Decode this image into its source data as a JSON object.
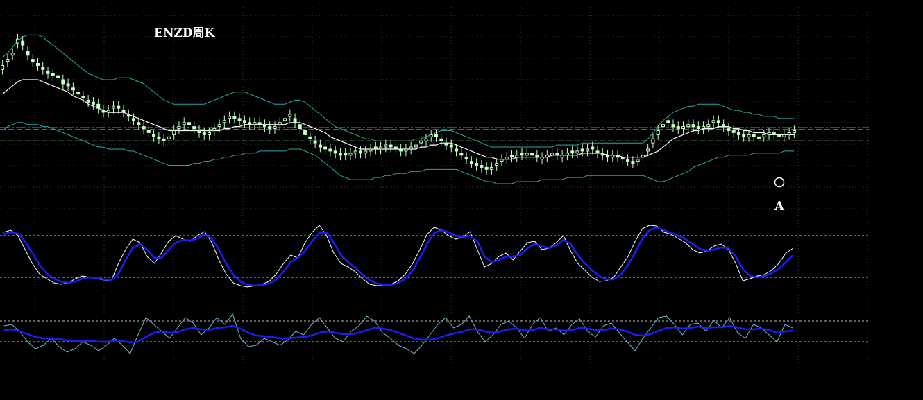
{
  "chart_data": {
    "title": "ENZD周K",
    "panels": [
      {
        "type": "candlestick",
        "bars": 158,
        "ylim": [
          0,
          100
        ],
        "candles_close": [
          74,
          77,
          80,
          87,
          84,
          79,
          76,
          74,
          72,
          70,
          69,
          68,
          65,
          64,
          62,
          60,
          58,
          56,
          55,
          53,
          51,
          52,
          54,
          53,
          51,
          49,
          47,
          45,
          43,
          41,
          39,
          38,
          37,
          39,
          42,
          44,
          46,
          45,
          43,
          41,
          40,
          41,
          43,
          45,
          47,
          49,
          48,
          47,
          46,
          45,
          46,
          45,
          44,
          43,
          44,
          46,
          48,
          50,
          46,
          43,
          40,
          38,
          36,
          34,
          33,
          32,
          31,
          30,
          30,
          31,
          32,
          31,
          32,
          33,
          33,
          34,
          35,
          34,
          33,
          32,
          33,
          34,
          35,
          37,
          38,
          40,
          39,
          37,
          35,
          34,
          32,
          30,
          28,
          26,
          25,
          24,
          23,
          24,
          26,
          28,
          29,
          29,
          30,
          30,
          31,
          30,
          29,
          29,
          30,
          31,
          30,
          30,
          31,
          31,
          32,
          32,
          33,
          33,
          31,
          30,
          29,
          30,
          29,
          28,
          27,
          26,
          28,
          30,
          33,
          38,
          42,
          45,
          46,
          44,
          43,
          44,
          45,
          44,
          43,
          44,
          45,
          47,
          46,
          44,
          42,
          41,
          40,
          39,
          40,
          39,
          38,
          40,
          41,
          40,
          39,
          40,
          41,
          42
        ],
        "candles_open": [
          72,
          76,
          79,
          85,
          86,
          81,
          77,
          75,
          73,
          71,
          70,
          69,
          67,
          65,
          63,
          61,
          59,
          57,
          56,
          55,
          52,
          51,
          53,
          54,
          52,
          50,
          48,
          46,
          44,
          42,
          40,
          39,
          38,
          38,
          40,
          43,
          45,
          46,
          44,
          42,
          41,
          40,
          42,
          44,
          46,
          48,
          49,
          48,
          47,
          46,
          45,
          46,
          45,
          44,
          43,
          45,
          47,
          49,
          48,
          45,
          42,
          39,
          37,
          35,
          34,
          33,
          32,
          31,
          31,
          30,
          31,
          32,
          31,
          32,
          34,
          33,
          34,
          35,
          34,
          33,
          32,
          33,
          34,
          36,
          37,
          39,
          40,
          38,
          36,
          35,
          33,
          31,
          29,
          27,
          26,
          25,
          24,
          23,
          25,
          27,
          28,
          30,
          29,
          31,
          30,
          31,
          30,
          28,
          29,
          30,
          31,
          29,
          30,
          32,
          31,
          33,
          32,
          34,
          32,
          31,
          30,
          29,
          30,
          29,
          28,
          27,
          27,
          29,
          32,
          36,
          40,
          44,
          47,
          45,
          44,
          43,
          44,
          45,
          44,
          43,
          44,
          46,
          47,
          45,
          43,
          42,
          41,
          40,
          39,
          40,
          39,
          39,
          40,
          41,
          40,
          39,
          40,
          41
        ],
        "ma_line": [
          60,
          62,
          64,
          66,
          67,
          67,
          67,
          67,
          66,
          65,
          64,
          63,
          62,
          61,
          59,
          58,
          57,
          55,
          54,
          53,
          52,
          51,
          51,
          51,
          51,
          50,
          49,
          48,
          47,
          46,
          45,
          44,
          43,
          42,
          42,
          42,
          42,
          42,
          42,
          42,
          42,
          42,
          42,
          42,
          43,
          43,
          44,
          44,
          45,
          45,
          45,
          45,
          45,
          45,
          45,
          45,
          45,
          46,
          46,
          46,
          45,
          44,
          43,
          42,
          41,
          39,
          38,
          37,
          36,
          35,
          34,
          33,
          33,
          33,
          33,
          33,
          33,
          33,
          33,
          33,
          33,
          33,
          33,
          34,
          34,
          35,
          35,
          36,
          36,
          36,
          35,
          34,
          33,
          32,
          31,
          30,
          29,
          29,
          28,
          28,
          28,
          28,
          29,
          29,
          29,
          29,
          29,
          29,
          29,
          30,
          30,
          30,
          30,
          30,
          30,
          31,
          31,
          31,
          31,
          31,
          30,
          30,
          30,
          29,
          29,
          29,
          29,
          29,
          30,
          31,
          32,
          34,
          36,
          38,
          39,
          40,
          41,
          42,
          42,
          43,
          43,
          43,
          44,
          44,
          44,
          43,
          43,
          42,
          42,
          41,
          41,
          41,
          40,
          40,
          40,
          40,
          40,
          40
        ],
        "bb_upper": [
          78,
          80,
          83,
          86,
          88,
          89,
          89,
          89,
          88,
          86,
          84,
          82,
          80,
          78,
          76,
          74,
          72,
          70,
          69,
          68,
          67,
          67,
          67,
          68,
          68,
          68,
          67,
          66,
          65,
          63,
          61,
          59,
          57,
          56,
          55,
          55,
          55,
          55,
          55,
          55,
          55,
          56,
          57,
          58,
          59,
          60,
          61,
          61,
          61,
          60,
          59,
          58,
          57,
          56,
          55,
          55,
          55,
          56,
          57,
          57,
          56,
          54,
          52,
          50,
          48,
          46,
          44,
          43,
          42,
          41,
          40,
          39,
          38,
          38,
          37,
          37,
          37,
          37,
          37,
          37,
          37,
          37,
          38,
          38,
          39,
          40,
          41,
          42,
          42,
          42,
          41,
          40,
          39,
          38,
          37,
          36,
          35,
          34,
          34,
          34,
          34,
          34,
          34,
          34,
          34,
          34,
          34,
          34,
          34,
          34,
          35,
          35,
          35,
          35,
          35,
          36,
          36,
          36,
          36,
          36,
          36,
          36,
          36,
          36,
          36,
          36,
          36,
          36,
          38,
          41,
          44,
          47,
          49,
          51,
          52,
          53,
          54,
          54,
          55,
          55,
          55,
          55,
          55,
          54,
          53,
          52,
          52,
          51,
          51,
          50,
          50,
          49,
          49,
          49,
          48,
          48,
          48,
          48
        ],
        "bb_lower": [
          42,
          44,
          45,
          46,
          46,
          45,
          45,
          45,
          44,
          44,
          43,
          42,
          41,
          40,
          39,
          38,
          37,
          36,
          35,
          34,
          34,
          33,
          33,
          33,
          33,
          32,
          32,
          31,
          30,
          29,
          28,
          27,
          26,
          25,
          25,
          25,
          25,
          25,
          26,
          26,
          27,
          27,
          28,
          28,
          29,
          29,
          30,
          30,
          31,
          31,
          31,
          32,
          32,
          32,
          32,
          32,
          32,
          33,
          33,
          33,
          32,
          31,
          30,
          28,
          26,
          24,
          22,
          20,
          19,
          18,
          18,
          18,
          18,
          18,
          19,
          19,
          20,
          20,
          21,
          21,
          21,
          22,
          22,
          22,
          23,
          23,
          23,
          23,
          23,
          23,
          23,
          22,
          21,
          20,
          19,
          18,
          17,
          17,
          16,
          16,
          16,
          16,
          17,
          17,
          17,
          17,
          17,
          18,
          18,
          18,
          18,
          18,
          19,
          19,
          19,
          19,
          20,
          20,
          20,
          20,
          20,
          20,
          20,
          20,
          20,
          20,
          20,
          20,
          19,
          18,
          17,
          17,
          18,
          19,
          20,
          21,
          22,
          24,
          25,
          26,
          27,
          28,
          29,
          29,
          30,
          30,
          30,
          30,
          30,
          31,
          31,
          31,
          31,
          31,
          31,
          32,
          32,
          32
        ],
        "support_levels": [
          43.5,
          42.5,
          37
        ]
      },
      {
        "type": "oscillator",
        "ylim": [
          0,
          100
        ],
        "levels": [
          80,
          20
        ],
        "fast": [
          85,
          88,
          80,
          60,
          40,
          25,
          18,
          12,
          10,
          12,
          18,
          22,
          20,
          18,
          16,
          15,
          40,
          60,
          75,
          70,
          50,
          40,
          55,
          72,
          80,
          75,
          72,
          80,
          86,
          70,
          45,
          25,
          12,
          8,
          6,
          8,
          10,
          14,
          25,
          40,
          52,
          48,
          70,
          85,
          95,
          80,
          55,
          40,
          35,
          28,
          18,
          10,
          8,
          8,
          10,
          15,
          25,
          40,
          60,
          82,
          92,
          88,
          80,
          75,
          78,
          86,
          60,
          35,
          40,
          50,
          55,
          45,
          58,
          70,
          72,
          60,
          62,
          70,
          80,
          58,
          40,
          30,
          20,
          14,
          15,
          20,
          35,
          50,
          72,
          90,
          95,
          94,
          85,
          82,
          76,
          70,
          60,
          55,
          58,
          65,
          68,
          60,
          40,
          15,
          18,
          22,
          24,
          30,
          40,
          55,
          62
        ],
        "slow": [
          82,
          85,
          83,
          72,
          55,
          38,
          26,
          18,
          14,
          12,
          14,
          18,
          20,
          19,
          17,
          16,
          25,
          45,
          62,
          68,
          60,
          48,
          48,
          60,
          70,
          74,
          73,
          76,
          82,
          76,
          60,
          40,
          24,
          14,
          9,
          8,
          9,
          11,
          17,
          28,
          42,
          48,
          58,
          72,
          84,
          85,
          70,
          52,
          42,
          34,
          24,
          16,
          11,
          9,
          9,
          12,
          18,
          30,
          48,
          68,
          84,
          88,
          85,
          80,
          78,
          80,
          72,
          50,
          42,
          45,
          50,
          50,
          52,
          62,
          68,
          65,
          62,
          66,
          74,
          68,
          52,
          40,
          30,
          22,
          17,
          17,
          24,
          38,
          56,
          76,
          88,
          92,
          88,
          84,
          80,
          75,
          68,
          61,
          58,
          60,
          63,
          62,
          50,
          32,
          22,
          20,
          22,
          26,
          32,
          42,
          52
        ]
      },
      {
        "type": "oscillator",
        "ylim": [
          0,
          100
        ],
        "levels": [
          65,
          35
        ],
        "fast": [
          58,
          60,
          50,
          35,
          25,
          30,
          40,
          28,
          20,
          25,
          35,
          30,
          22,
          30,
          40,
          30,
          18,
          45,
          70,
          60,
          50,
          40,
          55,
          70,
          62,
          45,
          55,
          70,
          60,
          75,
          40,
          28,
          30,
          40,
          35,
          30,
          38,
          50,
          45,
          60,
          70,
          55,
          40,
          35,
          50,
          58,
          72,
          65,
          48,
          40,
          30,
          25,
          18,
          30,
          45,
          60,
          70,
          55,
          60,
          72,
          50,
          35,
          45,
          60,
          65,
          55,
          40,
          60,
          70,
          50,
          55,
          45,
          60,
          68,
          50,
          42,
          58,
          62,
          48,
          35,
          22,
          40,
          55,
          70,
          72,
          60,
          45,
          60,
          62,
          50,
          66,
          55,
          70,
          48,
          40,
          60,
          55,
          45,
          35,
          60,
          55
        ],
        "slow": [
          52,
          53,
          50,
          46,
          42,
          40,
          40,
          39,
          37,
          36,
          36,
          36,
          35,
          35,
          36,
          36,
          34,
          35,
          42,
          48,
          50,
          48,
          49,
          53,
          55,
          53,
          52,
          55,
          56,
          58,
          54,
          48,
          44,
          43,
          42,
          40,
          40,
          41,
          42,
          44,
          48,
          50,
          48,
          46,
          46,
          48,
          52,
          55,
          54,
          52,
          48,
          44,
          40,
          38,
          38,
          40,
          44,
          47,
          49,
          53,
          53,
          50,
          48,
          50,
          53,
          54,
          51,
          52,
          55,
          53,
          53,
          51,
          52,
          55,
          54,
          52,
          52,
          54,
          53,
          50,
          45,
          44,
          46,
          51,
          55,
          56,
          54,
          55,
          57,
          55,
          56,
          56,
          58,
          56,
          53,
          53,
          54,
          52,
          48,
          50,
          51
        ]
      }
    ],
    "annotations": [
      {
        "label": "A",
        "marker": "circle"
      }
    ],
    "colors": {
      "background": "#000000",
      "grid": "#3a3a3a",
      "candle": "#c8ffc8",
      "ma": "#ffffff",
      "bands": "#2aa8a8",
      "support": "#7fd87f",
      "oscillator_fast": "#ffffff",
      "oscillator_slow": "#1c1cff",
      "rsi_fast": "#7ab8c8"
    },
    "grid": true
  }
}
